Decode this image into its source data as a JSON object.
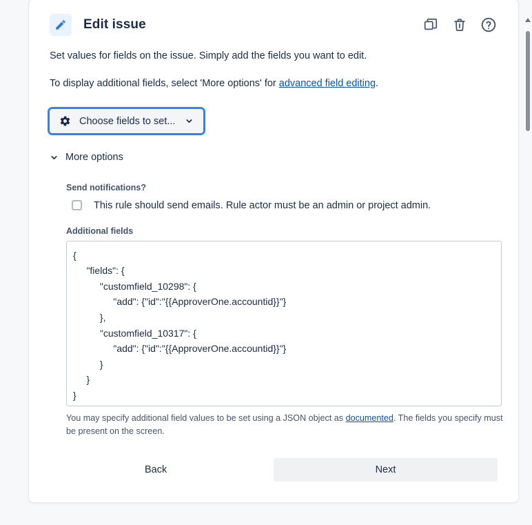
{
  "card": {
    "title": "Edit issue",
    "icon": "pencil-icon",
    "header_actions": [
      {
        "name": "duplicate-icon",
        "title": "Duplicate"
      },
      {
        "name": "trash-icon",
        "title": "Delete"
      },
      {
        "name": "help-icon",
        "title": "Help"
      }
    ],
    "description_line1": "Set values for fields on the issue. Simply add the fields you want to edit.",
    "description_line2_prefix": "To display additional fields, select 'More options' for ",
    "description_line2_link": "advanced field editing",
    "description_line2_suffix": ".",
    "choose_fields_label": "Choose fields to set...",
    "more_options_label": "More options"
  },
  "fields": {
    "send_notifications_label": "Send notifications?",
    "send_notifications_checkbox_label": "This rule should send emails. Rule actor must be an admin or project admin.",
    "send_notifications_checked": false,
    "additional_fields_label": "Additional fields",
    "additional_fields_value": "{\n     \"fields\": {\n          \"customfield_10298\": {\n               \"add\": {\"id\":\"{{ApproverOne.accountid}}\"}\n          },\n          \"customfield_10317\": {\n               \"add\": {\"id\":\"{{ApproverOne.accountid}}\"}\n          }\n     }\n}",
    "additional_fields_placeholder": "Enter JSON",
    "help_text_prefix": "You may specify additional field values to be set using a JSON object as ",
    "help_text_link": "documented",
    "help_text_suffix": ". The fields you specify must be present on the screen."
  },
  "footer": {
    "back_label": "Back",
    "next_label": "Next"
  },
  "colors": {
    "link": "#0052CC",
    "text": "#172B4D",
    "subtle_text": "#44546F",
    "accent_tile": "#E9F2FF",
    "focus_ring": "#2684FF",
    "button_bg": "#F0F1F3"
  }
}
